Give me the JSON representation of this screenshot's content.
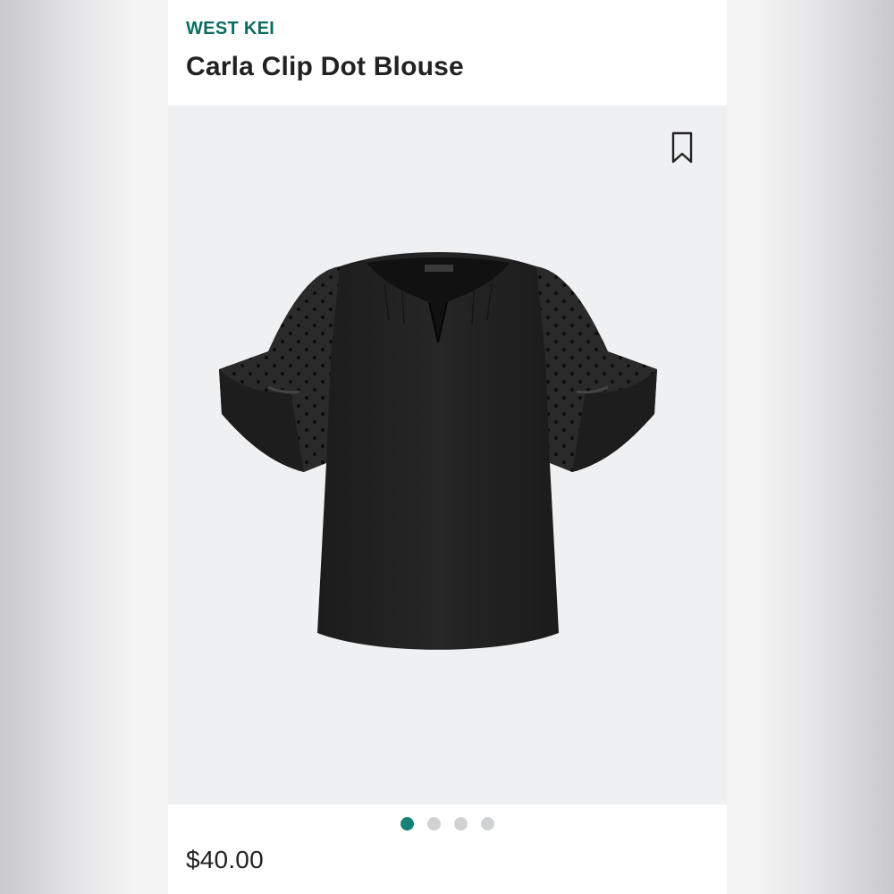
{
  "product": {
    "brand": "WEST KEI",
    "name": "Carla Clip Dot Blouse",
    "price": "$40.00",
    "image_subject": "black-short-sleeve-blouse"
  },
  "carousel": {
    "count": 4,
    "active_index": 0
  },
  "icons": {
    "bookmark": "bookmark-icon"
  },
  "colors": {
    "brand": "#0d6c61",
    "active_dot": "#15827a",
    "inactive_dot": "#d0d2d4",
    "image_bg": "#eff0f2",
    "text": "#222222"
  }
}
